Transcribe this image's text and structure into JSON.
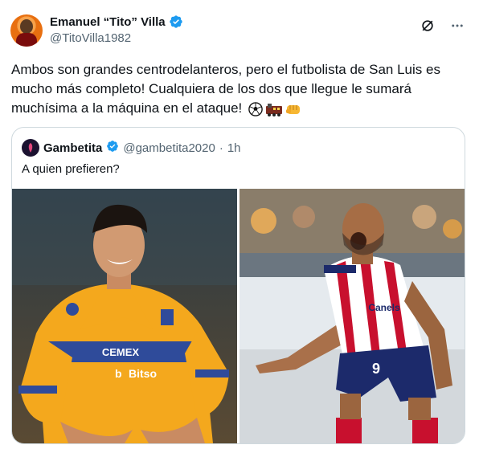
{
  "author": {
    "name": "Emanuel “Tito” Villa",
    "handle": "@TitoVilla1982"
  },
  "tweet": {
    "text": "Ambos son grandes centrodelanteros, pero el futbolista de San Luis es mucho más completo! Cualquiera de los dos que llegue le sumará muchísima a la máquina en el ataque!",
    "emojis": [
      "soccer-ball-icon",
      "train-icon",
      "fist-icon"
    ]
  },
  "quote": {
    "name": "Gambetita",
    "handle": "@gambetita2020",
    "separator": "·",
    "time": "1h",
    "text": "A quien prefieren?"
  },
  "photos": {
    "left_shirt_sponsor": "CEMEX",
    "left_shirt_sponsor2": "Bitso",
    "right_shirt_sponsor": "Canels",
    "right_number": "9"
  },
  "colors": {
    "verified": "#1d9bf0",
    "text_primary": "#0f1419",
    "text_secondary": "#536471",
    "border": "#cfd9de",
    "tigres_yellow": "#f4a81d",
    "tigres_blue": "#2f4b9a",
    "sanluis_red": "#c8102e"
  }
}
